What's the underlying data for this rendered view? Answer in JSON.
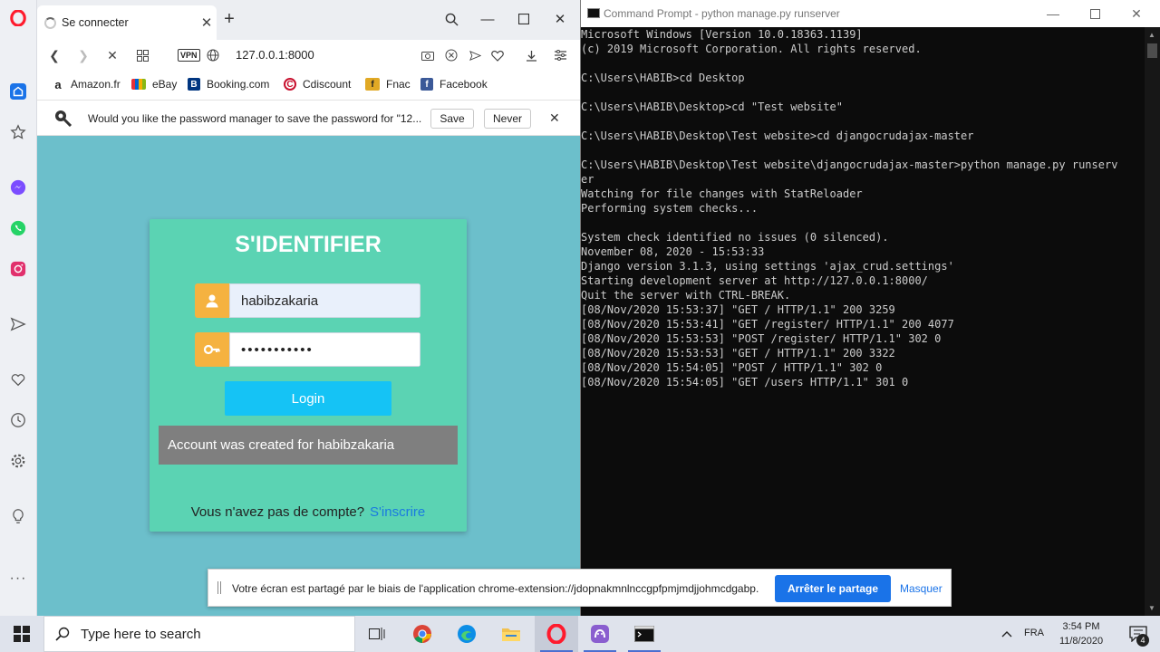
{
  "browser": {
    "tab_title": "Se connecter",
    "vpn_label": "VPN",
    "url": "127.0.0.1:8000",
    "bookmarks": [
      {
        "label": "Amazon.fr",
        "icon": "amazon-icon",
        "color": "#222222"
      },
      {
        "label": "eBay",
        "icon": "ebay-icon",
        "color": "#e53238"
      },
      {
        "label": "Booking.com",
        "icon": "booking-icon",
        "color": "#003580"
      },
      {
        "label": "Cdiscount",
        "icon": "cdiscount-icon",
        "color": "#c8102e"
      },
      {
        "label": "Fnac",
        "icon": "fnac-icon",
        "color": "#e1a925"
      },
      {
        "label": "Facebook",
        "icon": "facebook-icon",
        "color": "#3b5998"
      }
    ],
    "password_bar": {
      "text": "Would you like the password manager to save the password for \"12...",
      "save_label": "Save",
      "never_label": "Never"
    }
  },
  "login_page": {
    "title": "S'IDENTIFIER",
    "username_value": "habibzakaria",
    "password_value": "•••••••••••",
    "login_button": "Login",
    "alert": "Account was created for habibzakaria",
    "signup_prompt": "Vous n'avez pas de compte?",
    "signup_link": "S'inscrire",
    "colors": {
      "background": "#6cbfcb",
      "card": "#5bd3b3",
      "icon_box": "#f5b240",
      "button": "#15c3f5"
    }
  },
  "cmd": {
    "title": "Command Prompt - python  manage.py runserver",
    "lines": [
      "Microsoft Windows [Version 10.0.18363.1139]",
      "(c) 2019 Microsoft Corporation. All rights reserved.",
      "",
      "C:\\Users\\HABIB>cd Desktop",
      "",
      "C:\\Users\\HABIB\\Desktop>cd \"Test website\"",
      "",
      "C:\\Users\\HABIB\\Desktop\\Test website>cd djangocrudajax-master",
      "",
      "C:\\Users\\HABIB\\Desktop\\Test website\\djangocrudajax-master>python manage.py runserv",
      "er",
      "Watching for file changes with StatReloader",
      "Performing system checks...",
      "",
      "System check identified no issues (0 silenced).",
      "November 08, 2020 - 15:53:33",
      "Django version 3.1.3, using settings 'ajax_crud.settings'",
      "Starting development server at http://127.0.0.1:8000/",
      "Quit the server with CTRL-BREAK.",
      "[08/Nov/2020 15:53:37] \"GET / HTTP/1.1\" 200 3259",
      "[08/Nov/2020 15:53:41] \"GET /register/ HTTP/1.1\" 200 4077",
      "[08/Nov/2020 15:53:53] \"POST /register/ HTTP/1.1\" 302 0",
      "[08/Nov/2020 15:53:53] \"GET / HTTP/1.1\" 200 3322",
      "[08/Nov/2020 15:54:05] \"POST / HTTP/1.1\" 302 0",
      "[08/Nov/2020 15:54:05] \"GET /users HTTP/1.1\" 301 0"
    ]
  },
  "share_banner": {
    "text": "Votre écran est partagé par le biais de l'application chrome-extension://jdopnakmnlnccgpfpmjmdjjohmcdgabp.",
    "stop_label": "Arrêter le partage",
    "hide_label": "Masquer"
  },
  "taskbar": {
    "search_placeholder": "Type here to search",
    "language": "FRA",
    "time": "3:54 PM",
    "date": "11/8/2020",
    "notification_count": "4"
  }
}
